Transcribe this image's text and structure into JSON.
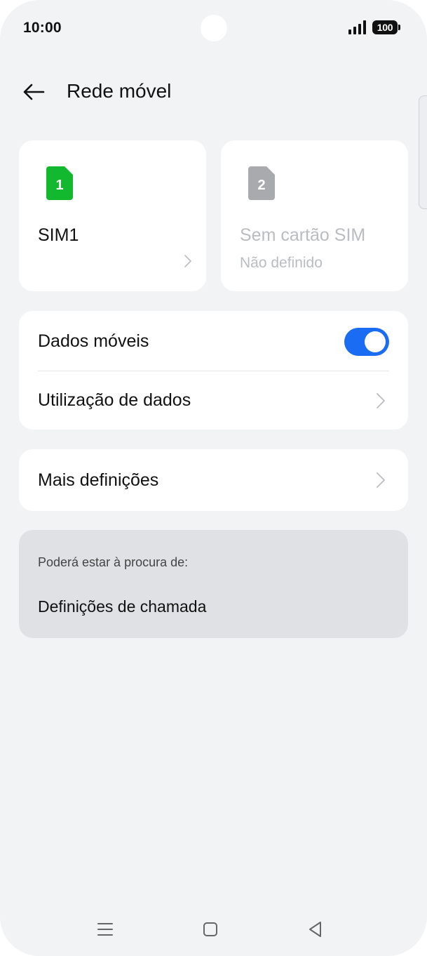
{
  "status_bar": {
    "time": "10:00",
    "battery": "100",
    "icons": [
      "signal-icon",
      "battery-icon"
    ]
  },
  "header": {
    "title": "Rede móvel",
    "back_icon": "arrow-left-icon"
  },
  "sims": [
    {
      "number": "1",
      "name": "SIM1",
      "subtitle": "",
      "active": true,
      "color": "#12b82e"
    },
    {
      "number": "2",
      "name": "Sem cartão SIM",
      "subtitle": "Não definido",
      "active": false,
      "color": "#a8aaae"
    }
  ],
  "mobile_data": {
    "label": "Dados móveis",
    "enabled": true,
    "toggle_color": "#1a6cf2"
  },
  "data_usage": {
    "label": "Utilização de dados"
  },
  "more_settings": {
    "label": "Mais definições"
  },
  "suggestions": {
    "title": "Poderá estar à procura de:",
    "items": [
      "Definições de chamada"
    ]
  },
  "nav_bar": {
    "icons": [
      "menu-icon",
      "home-icon",
      "back-icon"
    ]
  }
}
